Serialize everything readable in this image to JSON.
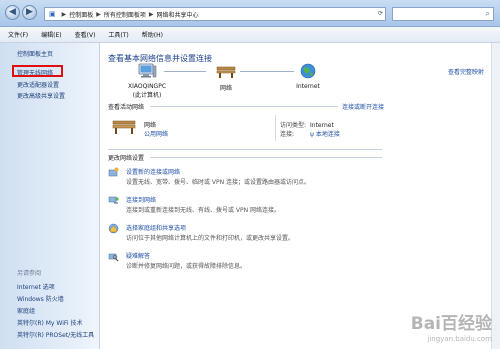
{
  "address": {
    "segments": [
      "控制面板",
      "所有控制面板项",
      "网络和共享中心"
    ],
    "separator": "▶"
  },
  "menubar": [
    "文件(F)",
    "编辑(E)",
    "查看(V)",
    "工具(T)",
    "帮助(H)"
  ],
  "sidebar": {
    "home": "控制面板主页",
    "items": [
      "管理无线网络",
      "更改适配器设置",
      "更改高级共享设置"
    ],
    "see_also_title": "另请参阅",
    "see_also": [
      "Internet 选项",
      "Windows 防火墙",
      "家庭组",
      "英特尔(R) My WiFi 技术",
      "英特尔(R) PROSet/无线工具"
    ]
  },
  "main": {
    "heading": "查看基本网络信息并设置连接",
    "view_map": "查看完整映射",
    "nodes": {
      "computer": "XIAOQINGPC",
      "computer_sub": "(此计算机)",
      "network": "网络",
      "internet": "Internet"
    },
    "active": {
      "title": "查看活动网络",
      "link": "连接或断开连接",
      "network_name": "网络",
      "network_type": "公用网络",
      "access_label": "访问类型:",
      "access_value": "Internet",
      "conn_label": "连接:",
      "conn_value": "本地连接"
    },
    "change": {
      "title": "更改网络设置",
      "tasks": [
        {
          "link": "设置新的连接或网络",
          "desc": "设置无线、宽带、拨号、临时或 VPN 连接；或设置路由器或访问点。"
        },
        {
          "link": "连接到网络",
          "desc": "连接到或重新连接到无线、有线、拨号或 VPN 网络连接。"
        },
        {
          "link": "选择家庭组和共享选项",
          "desc": "访问位于其他网络计算机上的文件和打印机，或更改共享设置。"
        },
        {
          "link": "疑难解答",
          "desc": "诊断并修复网络问题，或获得故障排除信息。"
        }
      ]
    }
  },
  "watermark": {
    "logo": "Bai百经验",
    "url": "jingyan.baidu.com"
  },
  "colors": {
    "link": "#1e4ea6",
    "heading": "#1a3f8c",
    "highlight": "#e01010"
  }
}
